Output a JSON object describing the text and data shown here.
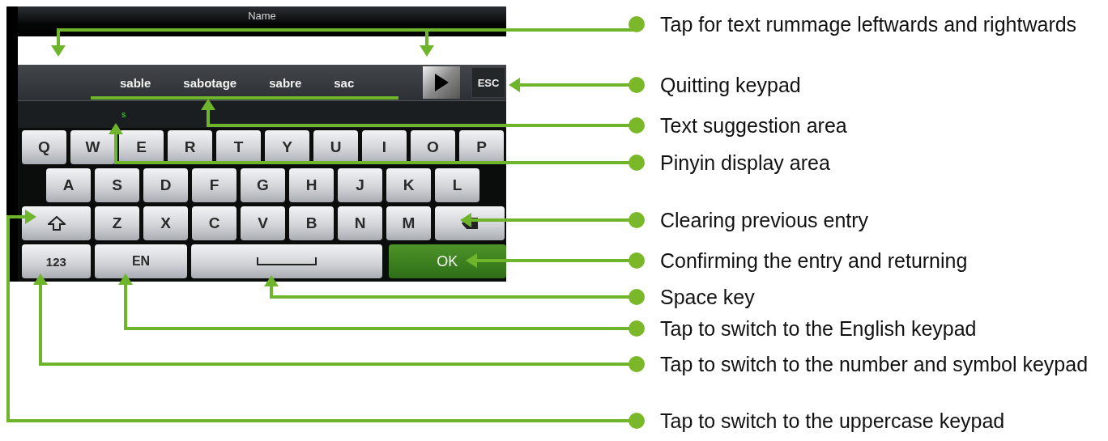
{
  "screen": {
    "title": "Name",
    "suggestions": [
      "sable",
      "sabotage",
      "sabre",
      "sac"
    ],
    "esc_key": "ESC",
    "pinyin": "s",
    "rows": [
      [
        {
          "kind": "letter",
          "label": "Q"
        },
        {
          "kind": "letter",
          "label": "W"
        },
        {
          "kind": "letter",
          "label": "E"
        },
        {
          "kind": "letter",
          "label": "R"
        },
        {
          "kind": "letter",
          "label": "T"
        },
        {
          "kind": "letter",
          "label": "Y"
        },
        {
          "kind": "letter",
          "label": "U"
        },
        {
          "kind": "letter",
          "label": "I"
        },
        {
          "kind": "letter",
          "label": "O"
        },
        {
          "kind": "letter",
          "label": "P"
        }
      ],
      [
        {
          "kind": "letter",
          "label": "A"
        },
        {
          "kind": "letter",
          "label": "S"
        },
        {
          "kind": "letter",
          "label": "D"
        },
        {
          "kind": "letter",
          "label": "F"
        },
        {
          "kind": "letter",
          "label": "G"
        },
        {
          "kind": "letter",
          "label": "H"
        },
        {
          "kind": "letter",
          "label": "J"
        },
        {
          "kind": "letter",
          "label": "K"
        },
        {
          "kind": "letter",
          "label": "L"
        }
      ],
      [
        {
          "kind": "shift"
        },
        {
          "kind": "letter",
          "label": "Z"
        },
        {
          "kind": "letter",
          "label": "X"
        },
        {
          "kind": "letter",
          "label": "C"
        },
        {
          "kind": "letter",
          "label": "V"
        },
        {
          "kind": "letter",
          "label": "B"
        },
        {
          "kind": "letter",
          "label": "N"
        },
        {
          "kind": "letter",
          "label": "M"
        },
        {
          "kind": "backspace"
        }
      ],
      [
        {
          "kind": "mode",
          "label": "123"
        },
        {
          "kind": "mode",
          "label": "EN"
        },
        {
          "kind": "space"
        },
        {
          "kind": "ok",
          "label": "OK"
        }
      ]
    ]
  },
  "callouts": [
    {
      "text": "Tap for text rummage leftwards and rightwards"
    },
    {
      "text": "Quitting keypad"
    },
    {
      "text": "Text suggestion area"
    },
    {
      "text": "Pinyin display area"
    },
    {
      "text": "Clearing previous entry"
    },
    {
      "text": "Confirming the entry and returning"
    },
    {
      "text": "Space key"
    },
    {
      "text": "Tap to switch to the English keypad"
    },
    {
      "text": "Tap to switch to the number and symbol keypad"
    },
    {
      "text": "Tap to switch to the uppercase keypad"
    }
  ]
}
